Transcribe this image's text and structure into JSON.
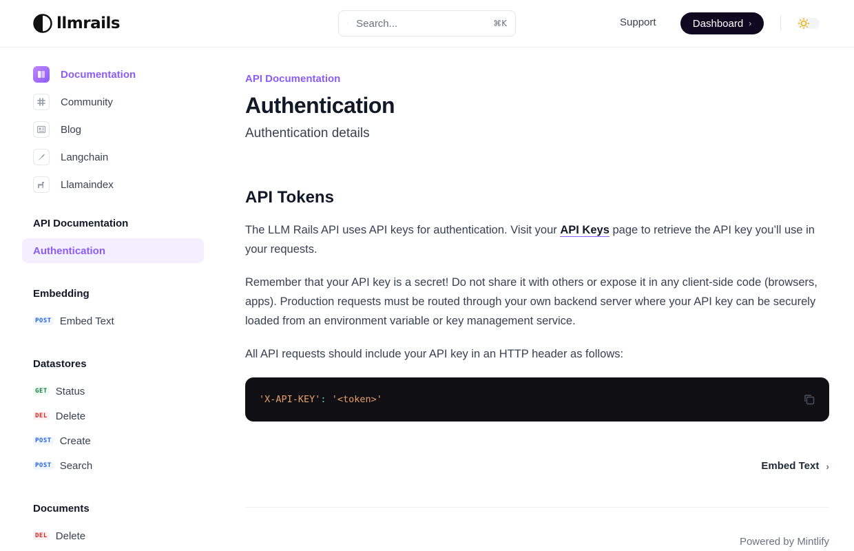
{
  "header": {
    "logo_text": "llmrails",
    "search_placeholder": "Search...",
    "search_shortcut": "⌘K",
    "support_label": "Support",
    "dashboard_label": "Dashboard"
  },
  "sidebar": {
    "top_links": [
      {
        "label": "Documentation",
        "icon": "book-icon",
        "active": true
      },
      {
        "label": "Community",
        "icon": "slack-icon"
      },
      {
        "label": "Blog",
        "icon": "newspaper-icon"
      },
      {
        "label": "Langchain",
        "icon": "bird-icon"
      },
      {
        "label": "Llamaindex",
        "icon": "llama-icon"
      }
    ],
    "sections": [
      {
        "title": "API Documentation",
        "items": [
          {
            "label": "Authentication",
            "selected": true
          }
        ]
      },
      {
        "title": "Embedding",
        "items": [
          {
            "method": "POST",
            "label": "Embed Text"
          }
        ]
      },
      {
        "title": "Datastores",
        "items": [
          {
            "method": "GET",
            "label": "Status"
          },
          {
            "method": "DEL",
            "label": "Delete"
          },
          {
            "method": "POST",
            "label": "Create"
          },
          {
            "method": "POST",
            "label": "Search"
          }
        ]
      },
      {
        "title": "Documents",
        "items": [
          {
            "method": "DEL",
            "label": "Delete"
          }
        ]
      }
    ]
  },
  "main": {
    "eyebrow": "API Documentation",
    "title": "Authentication",
    "subtitle": "Authentication details",
    "section_heading": "API Tokens",
    "para1_before": "The LLM Rails API uses API keys for authentication. Visit your ",
    "para1_link": "API Keys",
    "para1_after": " page to retrieve the API key you’ll use in your requests.",
    "para2": "Remember that your API key is a secret! Do not share it with others or expose it in any client-side code (browsers, apps). Production requests must be routed through your own backend server where your API key can be securely loaded from an environment variable or key management service.",
    "para3": "All API requests should include your API key in an HTTP header as follows:",
    "code_key": "'X-API-KEY'",
    "code_colon": ":",
    "code_value": "'<token>'",
    "next_label": "Embed Text",
    "powered_by": "Powered by Mintlify"
  },
  "colors": {
    "accent": "#8b5cf6",
    "dashboard_bg": "#0f0820",
    "code_bg": "#0f0f14"
  }
}
